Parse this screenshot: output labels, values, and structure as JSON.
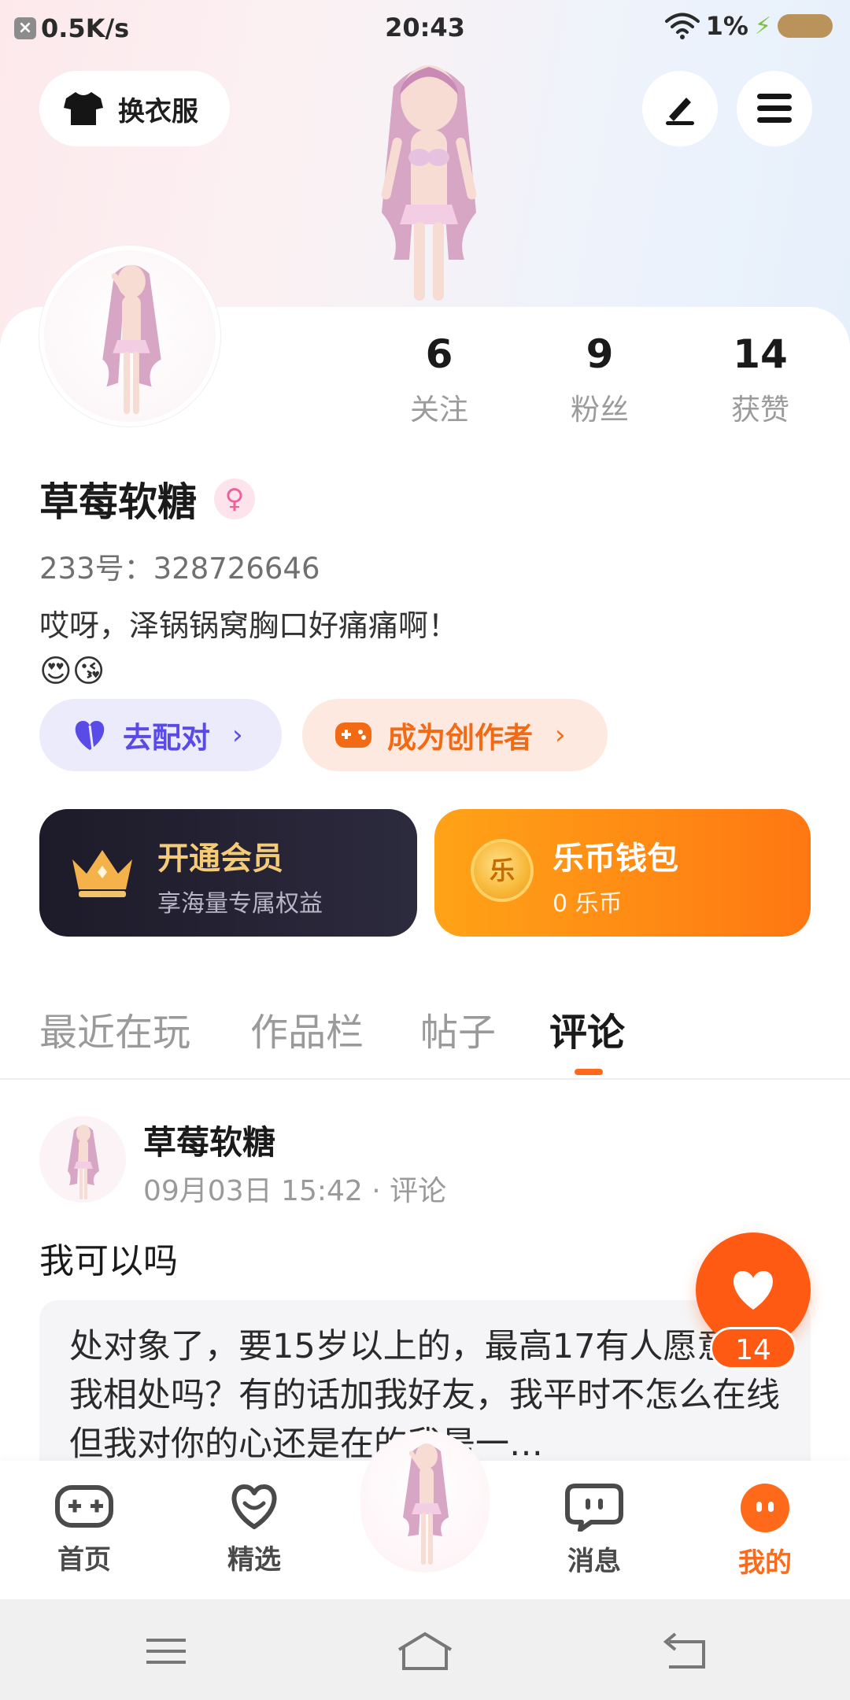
{
  "status_bar": {
    "net_speed": "0.5K/s",
    "time": "20:43",
    "battery": "1%"
  },
  "header": {
    "outfit_label": "换衣服"
  },
  "profile": {
    "stats": [
      {
        "num": "6",
        "label": "关注"
      },
      {
        "num": "9",
        "label": "粉丝"
      },
      {
        "num": "14",
        "label": "获赞"
      }
    ],
    "name": "草莓软糖",
    "uid": "233号：328726646",
    "bio": "哎呀，泽锅锅窝胸口好痛痛啊！",
    "bio_emoji": "😍😘"
  },
  "actions": {
    "pair_label": "去配对",
    "creator_label": "成为创作者",
    "chevron": "›"
  },
  "vip": {
    "title": "开通会员",
    "subtitle": "享海量专属权益"
  },
  "wallet": {
    "title": "乐币钱包",
    "subtitle": "0 乐币",
    "coin_char": "乐"
  },
  "tabs": [
    "最近在玩",
    "作品栏",
    "帖子",
    "评论"
  ],
  "active_tab": "评论",
  "post": {
    "author": "草莓软糖",
    "meta": "09月03日 15:42 · 评论",
    "text": "我可以吗",
    "quote": "处对象了，要15岁以上的，最高17有人愿意和我相处吗？有的话加我好友，我平时不怎么在线但我对你的心还是在的我是一…",
    "likes": "14"
  },
  "nav": {
    "items": [
      "首页",
      "精选",
      "消息",
      "我的"
    ],
    "active": "我的"
  },
  "colors": {
    "accent": "#ff6a1a",
    "pair": "#5a4ae6",
    "creator": "#f26a14",
    "vip_gold": "#f3cb79"
  },
  "icons": [
    "shirt-icon",
    "edit-icon",
    "menu-icon",
    "female-icon",
    "heart-icon",
    "gamepad-icon",
    "crown-icon",
    "coin-icon",
    "home-icon",
    "featured-icon",
    "message-icon",
    "profile-icon"
  ]
}
